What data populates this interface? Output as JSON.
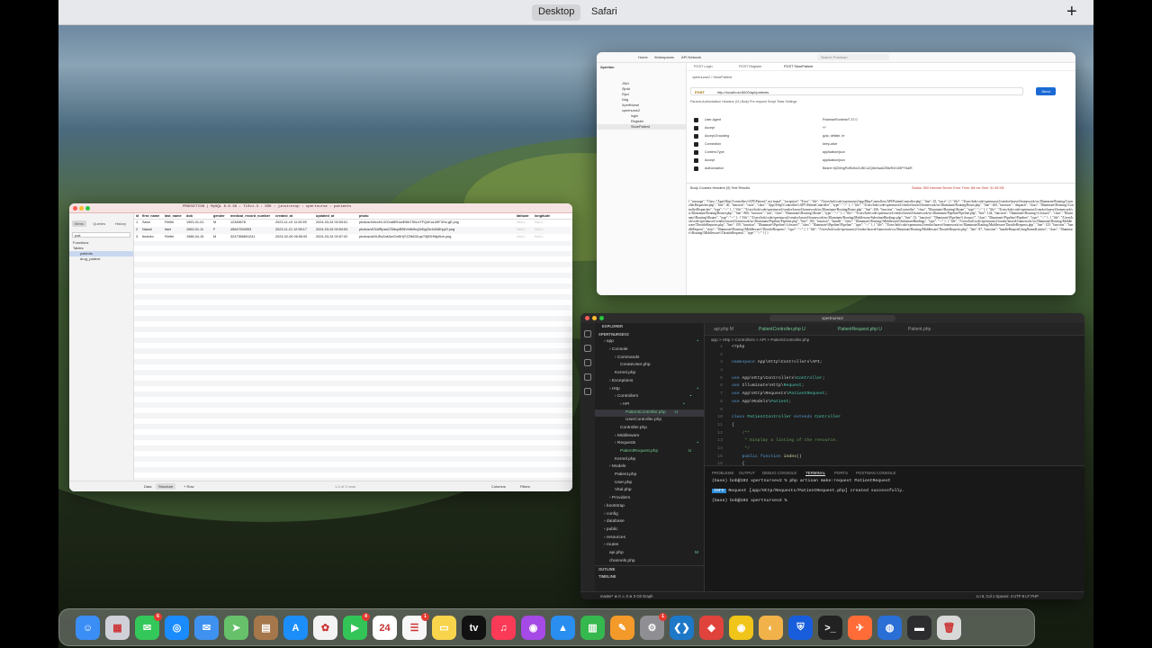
{
  "menubar": {
    "desktop": "Desktop",
    "safari": "Safari",
    "plus": "+"
  },
  "tableplus": {
    "status": "PRODUCTION | MySQL 8.0.36 : TLSv1.3 : SSH : jinstrotop : xpertnurse : patients",
    "tabs": [
      "Items",
      "Queries",
      "History"
    ],
    "search": "pati",
    "tree": [
      "Functions",
      "Tables",
      "patients",
      "drug_patient"
    ],
    "columns": [
      "id",
      "first_name",
      "last_name",
      "dob",
      "gender",
      "medical_record_number",
      "created_at",
      "updated_at",
      "photo",
      "latitude",
      "longitude"
    ],
    "rows": [
      [
        "1",
        "Sami",
        "Fleifel",
        "1953-01-01",
        "M",
        "12345678",
        "2023-11-19 11:00:59",
        "2024-03-24 00:53:51",
        "photos/xWcxHLXGXa8EEowE6fkTShLbTFQeKuLrf5F3Ho.gE.png",
        "NULL",
        "NULL"
      ],
      [
        "2",
        "Nawal",
        "Itani",
        "1963-01-11",
        "F",
        "45647534953",
        "2023-11-21 12:55:17",
        "2024-03-24 00:54:54",
        "photos/vEXdfRpzaCSWcp8R6Vrhfk9rq2bDgCkr4xD8KpyO.png",
        "NULL",
        "NULL"
      ],
      [
        "3",
        "Ibrahim",
        "Fleifel",
        "1988-04-15",
        "M",
        "3247358691241",
        "2024-02-09 06:55:00",
        "2024-03-24 00:57:02",
        "photos/aiXIUEsZaKAeCbWHjYZ2fbD5LqsT9j92HMpBxh.png",
        "NULL",
        "NULL"
      ]
    ],
    "bottom": {
      "data": "Data",
      "structure": "Structure",
      "row": "+ Row",
      "count": "1-3 of 3 rows",
      "columns": "Columns",
      "filters": "Filters"
    }
  },
  "postman": {
    "nav": [
      "Home",
      "Workspaces",
      "API Network"
    ],
    "search": "Search Postman",
    "workspace": "Xpertion",
    "tree": [
      "JWd",
      "Sjrdd",
      "Rjcd",
      "Ndg",
      "XpertNurse",
      "xpertnurse2",
      "login",
      "Register",
      "StorePatient"
    ],
    "tabs": [
      "POST Login",
      "POST Register",
      "POST StorePatient"
    ],
    "req_title": "xpertnurse2 / StorePatient",
    "method": "POST",
    "url": "http://localhost:8000/api/patients",
    "send": "Send",
    "req_tabs": "Params   Authorization   Headers (11)   Body   Pre-request Script   Tests   Settings",
    "headers": [
      [
        "User-Agent",
        "PostmanRuntime/7.37.0"
      ],
      [
        "Accept",
        "*/*"
      ],
      [
        "Accept-Encoding",
        "gzip, deflate, br"
      ],
      [
        "Connection",
        "keep-alive"
      ],
      [
        "Content-Type",
        "application/json"
      ],
      [
        "Accept",
        "application/json"
      ],
      [
        "Authorization",
        "Bearer 8|Z0rNgPwRoBxZLtBCuZQ6e2wa0ZBtzR4XJMPY5alR"
      ]
    ],
    "resp_tabs": "Body   Cookies   Headers (9)   Test Results",
    "resp_status": "Status: 500 Internal Server Error   Time: 88 ms   Size: 31.98 KB",
    "body": "{ \"message\": \"Class \\\"App\\\\Http\\\\Controllers\\\\API\\\\Patient\\\" not found\", \"exception\": \"Error\", \"file\": \"/Users/bob/code/xpertnurse2/app/Http/Controllers/API/PatientController.php\", \"line\": 25, \"trace\": [ { \"file\": \"/Users/bob/code/xpertnurse2/vendor/laravel/framework/src/Illuminate/Routing/ControllerDispatcher.php\", \"line\": 46, \"function\": \"store\", \"class\": \"App\\\\Http\\\\Controllers\\\\API\\\\PatientController\", \"type\": \"->\" }, { \"file\": \"/Users/bob/code/xpertnurse2/vendor/laravel/framework/src/Illuminate/Routing/Route.php\", \"line\": 260, \"function\": \"dispatch\", \"class\": \"Illuminate\\\\Routing\\\\ControllerDispatcher\", \"type\": \"->\" }, { \"file\": \"/Users/bob/code/xpertnurse2/vendor/laravel/framework/src/Illuminate/Routing/Route.php\", \"line\": 206, \"function\": \"runController\", \"class\": \"Illuminate\\\\Routing\\\\Route\", \"type\": \"->\" }, { \"file\": \"/Users/bob/code/xpertnurse2/vendor/laravel/framework/src/Illuminate/Routing/Router.php\", \"line\": 806, \"function\": \"run\", \"class\": \"Illuminate\\\\Routing\\\\Route\", \"type\": \"->\" }, { \"file\": \"/Users/bob/code/xpertnurse2/vendor/laravel/framework/src/Illuminate/Pipeline/Pipeline.php\", \"line\": 144, \"function\": \"Illuminate\\\\Routing\\\\{closure}\", \"class\": \"Illuminate\\\\Routing\\\\Router\", \"type\": \"->\" }, { \"file\": \"/Users/bob/code/xpertnurse2/vendor/laravel/framework/src/Illuminate/Routing/Middleware/SubstituteBindings.php\", \"line\": 51, \"function\": \"Illuminate\\\\Pipeline\\\\{closure}\", \"class\": \"Illuminate\\\\Pipeline\\\\Pipeline\", \"type\": \"->\" }, { \"file\": \"/Users/bob/code/xpertnurse2/vendor/laravel/framework/src/Illuminate/Pipeline/Pipeline.php\", \"line\": 183, \"function\": \"handle\", \"class\": \"Illuminate\\\\Routing\\\\Middleware\\\\SubstituteBindings\", \"type\": \"->\" }, { \"file\": \"/Users/bob/code/xpertnurse2/vendor/laravel/framework/src/Illuminate/Routing/Middleware/ThrottleRequests.php\", \"line\": 159, \"function\": \"Illuminate\\\\Pipeline\\\\{closure}\", \"class\": \"Illuminate\\\\Pipeline\\\\Pipeline\", \"type\": \"->\" }, { \"file\": \"/Users/bob/code/xpertnurse2/vendor/laravel/framework/src/Illuminate/Routing/Middleware/ThrottleRequests.php\", \"line\": 125, \"function\": \"handleRequest\", \"class\": \"Illuminate\\\\Routing\\\\Middleware\\\\ThrottleRequests\", \"type\": \"->\" }, { \"file\": \"/Users/bob/code/xpertnurse2/vendor/laravel/framework/src/Illuminate/Routing/Middleware/ThrottleRequests.php\", \"line\": 87, \"function\": \"handleRequestUsingNamedLimiter\", \"class\": \"Illuminate\\\\Routing\\\\Middleware\\\\ThrottleRequests\", \"type\": \"->\" } ] }"
  },
  "vscode": {
    "command": "xpertnurse2",
    "explorer_title": "EXPLORER",
    "project": "XPERTNURSEV2",
    "tree": [
      {
        "t": "app",
        "i": 1,
        "m": "•"
      },
      {
        "t": "Console",
        "i": 2,
        "m": ""
      },
      {
        "t": "Commands",
        "i": 3,
        "m": ""
      },
      {
        "t": "CreateUser.php",
        "i": 4,
        "m": ""
      },
      {
        "t": "Kernel.php",
        "i": 3,
        "m": ""
      },
      {
        "t": "Exceptions",
        "i": 2,
        "m": ""
      },
      {
        "t": "Http",
        "i": 2,
        "m": "•"
      },
      {
        "t": "Controllers",
        "i": 3,
        "m": "•"
      },
      {
        "t": "API",
        "i": 4,
        "m": "•"
      },
      {
        "t": "PatientController.php",
        "i": 5,
        "m": "U"
      },
      {
        "t": "UserController.php",
        "i": 5,
        "m": ""
      },
      {
        "t": "Controller.php",
        "i": 4,
        "m": ""
      },
      {
        "t": "Middleware",
        "i": 3,
        "m": ""
      },
      {
        "t": "Requests",
        "i": 3,
        "m": "•"
      },
      {
        "t": "PatientRequest.php",
        "i": 4,
        "m": "U"
      },
      {
        "t": "Kernel.php",
        "i": 3,
        "m": ""
      },
      {
        "t": "Models",
        "i": 2,
        "m": ""
      },
      {
        "t": "Patient.php",
        "i": 3,
        "m": ""
      },
      {
        "t": "User.php",
        "i": 3,
        "m": ""
      },
      {
        "t": "Vital.php",
        "i": 3,
        "m": ""
      },
      {
        "t": "Providers",
        "i": 2,
        "m": ""
      },
      {
        "t": "bootstrap",
        "i": 1,
        "m": ""
      },
      {
        "t": "config",
        "i": 1,
        "m": ""
      },
      {
        "t": "database",
        "i": 1,
        "m": ""
      },
      {
        "t": "public",
        "i": 1,
        "m": ""
      },
      {
        "t": "resources",
        "i": 1,
        "m": ""
      },
      {
        "t": "routes",
        "i": 1,
        "m": ""
      },
      {
        "t": "api.php",
        "i": 2,
        "m": "M"
      },
      {
        "t": "channels.php",
        "i": 2,
        "m": ""
      }
    ],
    "outline": "OUTLINE",
    "timeline": "TIMELINE",
    "tabs": [
      "api.php M",
      "PatientController.php U",
      "PatientRequest.php U",
      "Patient.php"
    ],
    "breadcrumb": "app > Http > Controllers > API > PatientController.php",
    "code": [
      "<?php",
      "",
      "namespace App\\Http\\Controllers\\API;",
      "",
      "use App\\Http\\Controllers\\Controller;",
      "use Illuminate\\Http\\Request;",
      "use App\\Http\\Requests\\PatientRequest;",
      "use App\\Models\\Patient;",
      "",
      "class PatientController extends Controller",
      "{",
      "    /**",
      "     * Display a listing of the resource.",
      "     */",
      "    public function index()",
      "    {",
      "        //"
    ],
    "panel_tabs": [
      "PROBLEMS",
      "OUTPUT",
      "DEBUG CONSOLE",
      "TERMINAL",
      "PORTS",
      "POSTMAN CONSOLE"
    ],
    "term1": "(base) bob@192 xpertnursev2 % php artisan make:request PatientRequest",
    "term_info": "INFO",
    "term2": "Request [app/Http/Requests/PatientRequest.php] created successfully.",
    "term3": "(base) bob@192 xpertnursev2 % ",
    "status_left": "master*   ⊗ 0 ⚠ 0   ⊗ 0   Git Graph",
    "status_right": "Ln 8, Col 1   Spaces: 4   UTF-8   LF   PHP"
  },
  "dock": {
    "apps": [
      {
        "name": "finder-icon",
        "color": "#3a8ef6",
        "glyph": "☺"
      },
      {
        "name": "launchpad-icon",
        "color": "#d0d0d8",
        "glyph": "▦"
      },
      {
        "name": "messages-icon",
        "color": "#34c759",
        "glyph": "✉",
        "badge": "6"
      },
      {
        "name": "safari-icon",
        "color": "#1a8cff",
        "glyph": "◎"
      },
      {
        "name": "mail-icon",
        "color": "#3f91f0",
        "glyph": "✉"
      },
      {
        "name": "maps-icon",
        "color": "#67c16b",
        "glyph": "➤"
      },
      {
        "name": "notes-brown-icon",
        "color": "#a6774a",
        "glyph": "▤"
      },
      {
        "name": "app-store-icon",
        "color": "#1c8ef9",
        "glyph": "A"
      },
      {
        "name": "photos-icon",
        "color": "#f3f3f3",
        "glyph": "✿"
      },
      {
        "name": "facetime-icon",
        "color": "#33c457",
        "glyph": "▶",
        "badge": "4"
      },
      {
        "name": "calendar-icon",
        "color": "#ffffff",
        "glyph": "24"
      },
      {
        "name": "reminders-icon",
        "color": "#f7f7f7",
        "glyph": "☰",
        "badge": "1"
      },
      {
        "name": "notes-icon",
        "color": "#f8d44c",
        "glyph": "▭"
      },
      {
        "name": "apple-tv-icon",
        "color": "#111111",
        "glyph": "tv"
      },
      {
        "name": "music-icon",
        "color": "#fb3a57",
        "glyph": "♫"
      },
      {
        "name": "podcasts-icon",
        "color": "#a54ae6",
        "glyph": "◉"
      },
      {
        "name": "keynote-icon",
        "color": "#2a8ef0",
        "glyph": "▲"
      },
      {
        "name": "numbers-icon",
        "color": "#35b84d",
        "glyph": "▥"
      },
      {
        "name": "pages-icon",
        "color": "#f49a2a",
        "glyph": "✎"
      },
      {
        "name": "system-settings-icon",
        "color": "#8e8e93",
        "glyph": "⚙",
        "badge": "1"
      },
      {
        "name": "vscode-icon",
        "color": "#1e78c8",
        "glyph": "❮❯"
      },
      {
        "name": "git-icon",
        "color": "#e0433c",
        "glyph": "◆"
      },
      {
        "name": "chrome-icon",
        "color": "#f0c419",
        "glyph": "◉"
      },
      {
        "name": "sequel-icon",
        "color": "#f2b24a",
        "glyph": "◐"
      },
      {
        "name": "bitwarden-icon",
        "color": "#175ddc",
        "glyph": "⛨"
      },
      {
        "name": "terminal-icon",
        "color": "#222222",
        "glyph": ">_"
      },
      {
        "name": "postman-icon",
        "color": "#ff6c37",
        "glyph": "✈"
      },
      {
        "name": "proxyman-icon",
        "color": "#2a6fd6",
        "glyph": "◍"
      },
      {
        "name": "downloads-icon",
        "color": "#2c2c2e",
        "glyph": "▬"
      },
      {
        "name": "trash-icon",
        "color": "#d8d8d8",
        "glyph": "🗑"
      }
    ]
  }
}
